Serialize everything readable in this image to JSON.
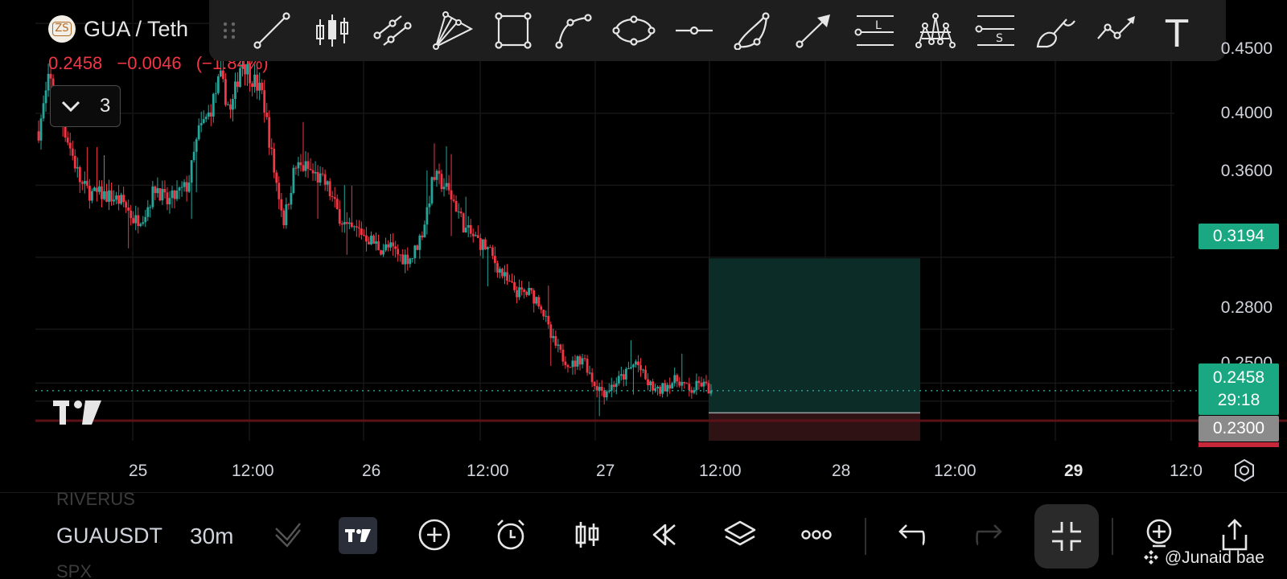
{
  "header": {
    "symbol_title": "GUA / Teth",
    "last_price": "0.2458",
    "change_abs": "−0.0046",
    "change_pct": "(−1.84%)",
    "indicators_toggle_icon": "chevron-down-icon",
    "indicators_count": "3"
  },
  "drawing_toolbar": {
    "tools": [
      "trend-line-icon",
      "candles-icon",
      "parallel-channel-icon",
      "pitchfork-icon",
      "rectangle-icon",
      "path-icon",
      "ellipse-icon",
      "horizontal-ray-icon",
      "arc-icon",
      "arrow-icon",
      "long-position-icon",
      "pattern-icon",
      "short-position-icon",
      "brush-icon",
      "polyline-icon",
      "text-icon"
    ],
    "long_label": "L",
    "short_label": "S",
    "text_label": "T"
  },
  "price_axis": {
    "labels": [
      "0.4500",
      "0.4000",
      "0.3600",
      "0.2800",
      "0.2500"
    ],
    "target_badge": "0.3194",
    "current_badge_price": "0.2458",
    "current_badge_countdown": "29:18",
    "stop_badge": "0.2300"
  },
  "time_axis": {
    "labels": [
      "25",
      "12:00",
      "26",
      "12:00",
      "27",
      "12:00",
      "28",
      "12:00",
      "29",
      "12:0"
    ],
    "bold_label": "29"
  },
  "chart_data": {
    "type": "candlestick",
    "x_ticks": [
      "25",
      "12:00",
      "26",
      "12:00",
      "27",
      "12:00",
      "28",
      "12:00",
      "29",
      "12:0"
    ],
    "y_ticks": [
      0.45,
      0.4,
      0.36,
      0.28,
      0.25
    ],
    "ylim": [
      0.218,
      0.463
    ],
    "interval": "30m",
    "close_path": [
      0.39,
      0.42,
      0.4,
      0.38,
      0.36,
      0.355,
      0.355,
      0.353,
      0.35,
      0.34,
      0.345,
      0.36,
      0.35,
      0.355,
      0.36,
      0.39,
      0.4,
      0.42,
      0.4,
      0.43,
      0.42,
      0.41,
      0.37,
      0.34,
      0.37,
      0.37,
      0.365,
      0.36,
      0.345,
      0.335,
      0.335,
      0.33,
      0.325,
      0.325,
      0.32,
      0.32,
      0.335,
      0.365,
      0.36,
      0.35,
      0.335,
      0.33,
      0.325,
      0.315,
      0.305,
      0.3,
      0.3,
      0.295,
      0.275,
      0.265,
      0.26,
      0.265,
      0.25,
      0.245,
      0.25,
      0.255,
      0.262,
      0.25,
      0.245,
      0.25,
      0.252,
      0.245,
      0.25,
      0.2458
    ],
    "current_price": 0.2458,
    "position": {
      "type": "long",
      "target": 0.3194,
      "entry": 0.2335,
      "stop": 0.23
    },
    "grid": true
  },
  "bottom_bar": {
    "ghost_top": "RIVERUS",
    "symbol": "GUAUSDT",
    "interval": "30m",
    "ghost_bottom": "SPX",
    "watermark": "@Junaid bae"
  },
  "colors": {
    "up": "#26a69a",
    "down": "#f23645",
    "target_zone": "#0b2c27",
    "stop_zone": "#2f1214",
    "badge_green": "#1aa883",
    "badge_gray": "#8b8b8b",
    "toolbar_bg": "#1e1e1e"
  }
}
